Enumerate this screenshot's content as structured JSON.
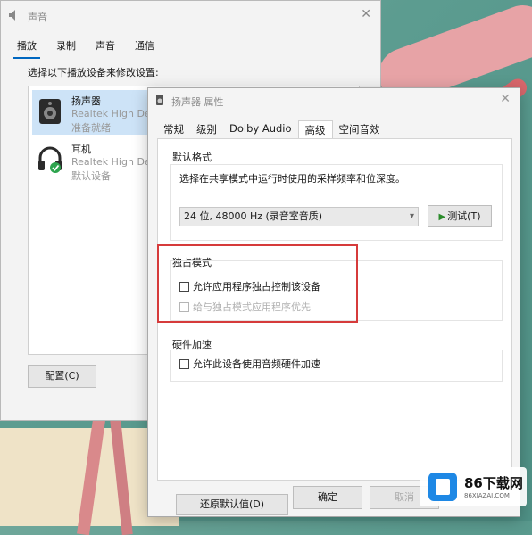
{
  "back_window": {
    "title": "声音",
    "tabs": [
      "播放",
      "录制",
      "声音",
      "通信"
    ],
    "active_tab": "播放",
    "hint": "选择以下播放设备来修改设置:",
    "devices": [
      {
        "name": "扬声器",
        "driver": "Realtek High Defi",
        "status": "准备就绪",
        "icon": "speaker-icon"
      },
      {
        "name": "耳机",
        "driver": "Realtek High Defi",
        "status": "默认设备",
        "icon": "headphones-icon"
      }
    ],
    "config_button": "配置(C)"
  },
  "dialog": {
    "title": "扬声器 属性",
    "tabs": [
      "常规",
      "级别",
      "Dolby Audio",
      "高级",
      "空间音效"
    ],
    "active_tab": "高级",
    "default_format": {
      "label": "默认格式",
      "description": "选择在共享模式中运行时使用的采样频率和位深度。",
      "selected": "24 位, 48000 Hz (录音室音质)",
      "test_button": "测试(T)"
    },
    "exclusive_mode": {
      "label": "独占模式",
      "allow_exclusive": "允许应用程序独占控制该设备",
      "priority": "给与独占模式应用程序优先"
    },
    "hardware_accel": {
      "label": "硬件加速",
      "allow_hw": "允许此设备使用音频硬件加速"
    },
    "restore_button": "还原默认值(D)",
    "ok_button": "确定",
    "cancel_button": "取消"
  },
  "watermark": {
    "brand": "86下载网",
    "sub": "86XIAZAI.COM"
  },
  "colors": {
    "accent": "#0067c0",
    "highlight_box": "#d63b3b",
    "selection": "#cde3f7"
  }
}
